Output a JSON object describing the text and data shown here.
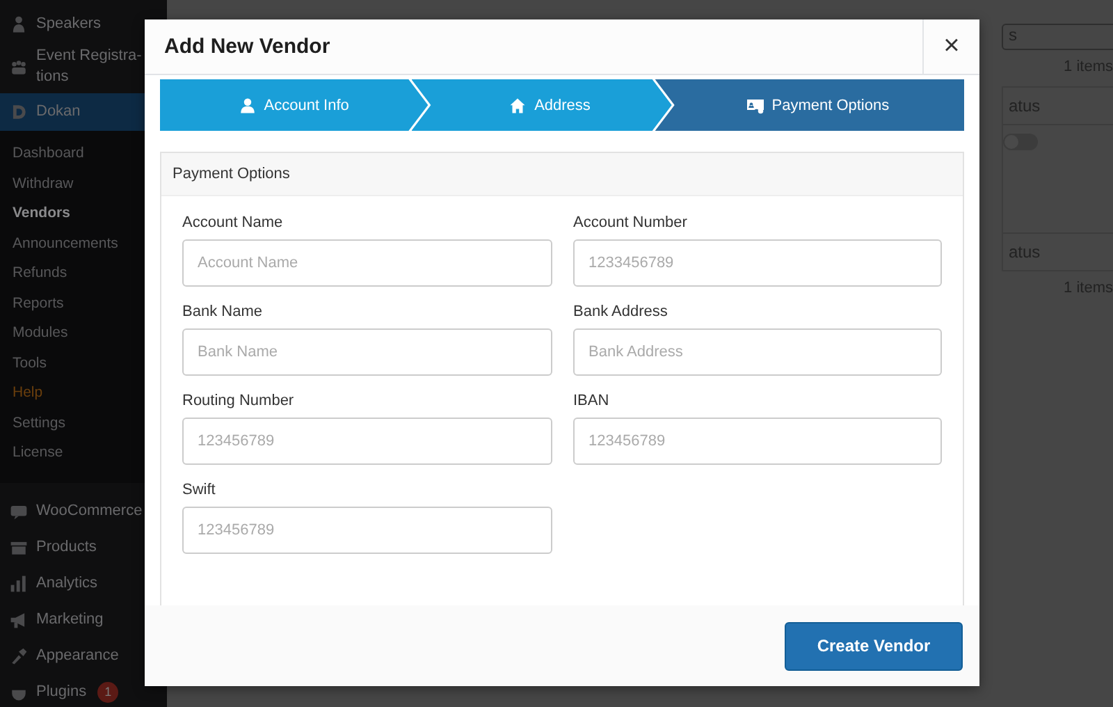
{
  "sidebar": {
    "items": [
      {
        "label": "Speakers",
        "selected": false
      },
      {
        "label": "Event Registra-tions",
        "selected": false
      },
      {
        "label": "Dokan",
        "selected": true,
        "children": [
          {
            "label": "Dashboard",
            "selected": false
          },
          {
            "label": "Withdraw",
            "selected": false
          },
          {
            "label": "Vendors",
            "selected": true
          },
          {
            "label": "Announcements",
            "selected": false
          },
          {
            "label": "Refunds",
            "selected": false
          },
          {
            "label": "Reports",
            "selected": false
          },
          {
            "label": "Modules",
            "selected": false
          },
          {
            "label": "Tools",
            "selected": false
          },
          {
            "label": "Help",
            "selected": false,
            "color": "#6b3f0d"
          },
          {
            "label": "Settings",
            "selected": false
          },
          {
            "label": "License",
            "selected": false
          }
        ]
      },
      {
        "label": "WooCommerce",
        "selected": false
      },
      {
        "label": "Products",
        "selected": false
      },
      {
        "label": "Analytics",
        "selected": false
      },
      {
        "label": "Marketing",
        "selected": false
      },
      {
        "label": "Appearance",
        "selected": false
      },
      {
        "label": "Plugins",
        "selected": false,
        "badge": "1"
      }
    ]
  },
  "background": {
    "button_fragment": "s",
    "items_count_top": "1 items",
    "column_header_top": "atus",
    "column_header_bottom": "atus",
    "items_count_bottom": "1 items",
    "toggle": {
      "on": false
    }
  },
  "dialog": {
    "title": "Add New Vendor",
    "close": "×",
    "steps": [
      {
        "label": "Account Info",
        "selected": false
      },
      {
        "label": "Address",
        "selected": false
      },
      {
        "label": "Payment Options",
        "selected": true
      }
    ],
    "section_title": "Payment Options",
    "fields": [
      {
        "label": "Account Name",
        "placeholder": "Account Name"
      },
      {
        "label": "Account Number",
        "placeholder": "1233456789"
      },
      {
        "label": "Bank Name",
        "placeholder": "Bank Name"
      },
      {
        "label": "Bank Address",
        "placeholder": "Bank Address"
      },
      {
        "label": "Routing Number",
        "placeholder": "123456789"
      },
      {
        "label": "IBAN",
        "placeholder": "123456789"
      },
      {
        "label": "Swift",
        "placeholder": "123456789"
      }
    ],
    "submit": "Create Vendor"
  }
}
